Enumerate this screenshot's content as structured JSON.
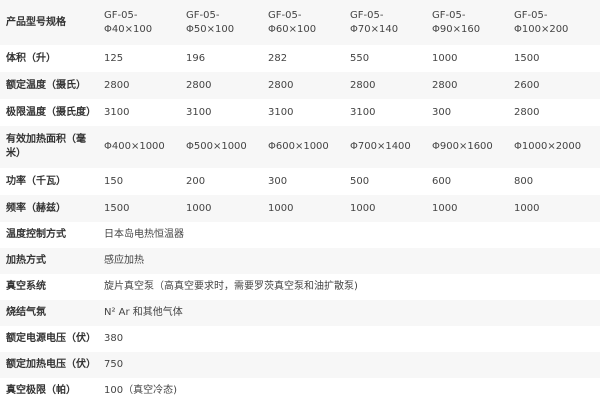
{
  "table": {
    "header": {
      "label": "产品型号规格",
      "models": [
        {
          "line1": "GF-05-",
          "line2": "Φ40×100"
        },
        {
          "line1": "GF-05-",
          "line2": "Φ50×100"
        },
        {
          "line1": "GF-05-",
          "line2": "Φ60×100"
        },
        {
          "line1": "GF-05-",
          "line2": "Φ70×140"
        },
        {
          "line1": "GF-05-",
          "line2": "Φ90×160"
        },
        {
          "line1": "GF-05-",
          "line2": "Φ100×200"
        }
      ]
    },
    "rows": [
      {
        "label": "体积（升）",
        "values": [
          "125",
          "196",
          "282",
          "550",
          "1000",
          "1500"
        ]
      },
      {
        "label": "额定温度（摄氏）",
        "values": [
          "2800",
          "2800",
          "2800",
          "2800",
          "2800",
          "2600"
        ]
      },
      {
        "label": "极限温度（摄氏度）",
        "values": [
          "3100",
          "3100",
          "3100",
          "3100",
          "300",
          "2800"
        ]
      },
      {
        "label": "有效加热面积（毫米）",
        "values": [
          "Φ400×1000",
          "Φ500×1000",
          "Φ600×1000",
          "Φ700×1400",
          "Φ900×1600",
          "Φ1000×2000"
        ]
      },
      {
        "label": "功率（千瓦）",
        "values": [
          "150",
          "200",
          "300",
          "500",
          "600",
          "800"
        ]
      },
      {
        "label": "频率（赫兹）",
        "values": [
          "1500",
          "1000",
          "1000",
          "1000",
          "1000",
          "1000"
        ]
      },
      {
        "label": "温度控制方式",
        "value": "日本岛电热恒温器"
      },
      {
        "label": "加热方式",
        "value": "感应加热"
      },
      {
        "label": "真空系统",
        "value": "旋片真空泵（高真空要求时，需要罗茨真空泵和油扩散泵)"
      },
      {
        "label": "烧结气氛",
        "value": "N² Ar 和其他气体"
      },
      {
        "label": "额定电源电压（伏）",
        "value": "380"
      },
      {
        "label": "额定加热电压（伏）",
        "value": "750"
      },
      {
        "label": "真空极限（帕）",
        "value": "100（真空冷态)"
      }
    ]
  }
}
